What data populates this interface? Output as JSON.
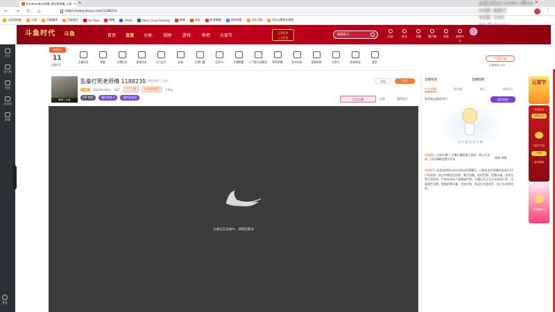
{
  "browser": {
    "tab_title": "BandanaBoy直播_绝区零直播_斗鱼",
    "url": "https://www.douyu.com/1188231",
    "bookmarks": [
      "斗鱼游戏推",
      "斗鱼",
      "百度翻译",
      "百度图片",
      "YouTube",
      "微博",
      "OPGG",
      "Xbox Cloud Gaming",
      "微博",
      "淘宝",
      "新浪微博",
      "我的网盘",
      "LOL豆腐",
      "LOL五期排位赛跑"
    ]
  },
  "overlay": {
    "line1": "白猫 [Bto]",
    "line2": "QQ群: 别看了",
    "line3": "QQ群: 100k",
    "line4": "QQ 乱 Tuelan",
    "clock": "19:00 23:00"
  },
  "header": {
    "logo": "斗鱼时代",
    "logo_sub": "斗鱼",
    "nav": [
      "首页",
      "直播",
      "分类·",
      "视频·",
      "游戏·",
      "鱼吧",
      "元宵节"
    ],
    "nav_active": "直播",
    "event_badge_top": "元宵佳节",
    "event_badge_bottom": "上元灯会",
    "search_placeholder": "搜索的人",
    "icons": [
      "历史",
      "关注",
      "开播",
      "客户端",
      "消息",
      "创作中心"
    ]
  },
  "sidebar": {
    "items": [
      "关注",
      "排行榜",
      "游戏",
      "云游戏",
      "赛事"
    ],
    "bottom": "更多"
  },
  "category": {
    "rank_pill": "周榜排名",
    "rank_number": "11",
    "rank_label": "主播积分",
    "items": [
      "主播开关",
      "弹幕",
      "主播任务",
      "星推任务",
      "火力全开",
      "友情",
      "主播口播",
      "全民PK",
      "开播提醒",
      "小飞鱼分成服务",
      "帮帮收藏",
      "发布动态",
      "视频投稿",
      "斗鱼FL",
      "鱼粉挑战",
      "更多"
    ],
    "pc_button": "PC客户端",
    "level_text": "主播等级 LV58"
  },
  "room": {
    "title": "乱拳打死老师傅 1188231",
    "tag1": "举报  单机热游 > 其它",
    "streamer": "BandanaBoy",
    "level": "Lv60",
    "followers": "807",
    "tag_new": "人气主播",
    "tag_hot": "本周热度第2",
    "heat": "7.8kg",
    "tag_vip": "VIP 特权",
    "tag_fan1": "福利热榜 6",
    "tag_fan2": "福利粉丝团",
    "thumb_label": "鱼吧 | 公告",
    "report_btn": "举报",
    "follow_btn": "关注",
    "banner_btn": "打卖主播",
    "share": "分享",
    "hint": "福利提示"
  },
  "video": {
    "loading_text": "主播正在加油中，请稍后重试"
  },
  "right_panel": {
    "tabs_top": [
      "主播背景",
      "直播回看"
    ],
    "tabs": [
      "今日贡献",
      "周贡献",
      "排行",
      "贵宾[0]"
    ],
    "tabs_active": "今日贡献",
    "fan_row": "独家粉丝精彩排行",
    "fan_btn": "成为粉丝",
    "mascot_caption": "这 么 粉 丝 有 么 嘛",
    "chat_meta": "收藏  弹幕",
    "sys_label1": "系统提示",
    "msg1": "已经开播了 主播开播直播上要求，默认为关闭，可在弹幕设置中开启",
    "sys_label2": "系统提示",
    "msg2": "欢迎来到BandanaBoy的直播间。斗鱼依法对直播内容进行24小时巡查，禁止传播违法违规、暴力血腥、低俗色情、招嫖诈骗、违禁品等不良信息，严禁未成年人直播或打赏。主播以不正当方式诱导打赏，注意理性消费。警惕招聘诈骗、代练代购、购买礼包游戏币、私下交易等信息。"
  },
  "ads": {
    "ad1_text": "元宵节",
    "ad2_line1": "本周活动",
    "ad2_btn1": "领取活动",
    "ad2_line2": "连续7天抢",
    "ad2_btn2": "开抢",
    "ad2_line3": "超过限额",
    "ad3_line1": "活动周边",
    "ad3_line2": "领主播周边"
  }
}
